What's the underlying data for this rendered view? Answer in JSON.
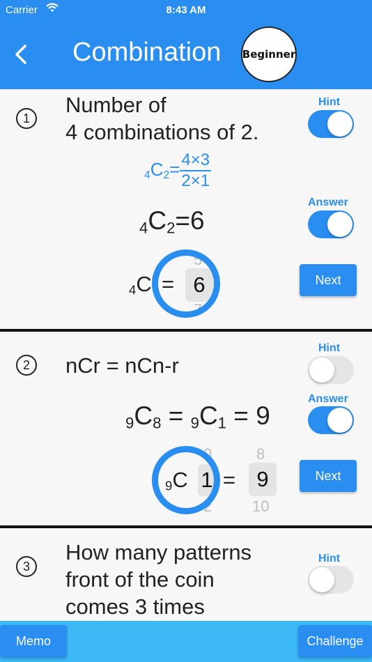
{
  "status": {
    "carrier": "Carrier",
    "time": "8:43 AM"
  },
  "header": {
    "title": "Combination",
    "badge": "Beginner"
  },
  "problems": [
    {
      "number": "1",
      "question": [
        "Number of",
        "4 combinations of 2."
      ],
      "hint_label": "Hint",
      "hint_on": true,
      "hint_formula": {
        "n": "4",
        "c": "C",
        "r": "2",
        "eq": "=",
        "numerator": "4×3",
        "denominator": "2×1"
      },
      "answer_label": "Answer",
      "answer_on": true,
      "answer_formula": {
        "n": "4",
        "c": "C",
        "r": "2",
        "eq": "=",
        "value": "6"
      },
      "input": {
        "n": "4",
        "c": "C",
        "eq": "=",
        "value": "6",
        "ghost_above": "5",
        "ghost_below": "7"
      },
      "next_label": "Next"
    },
    {
      "number": "2",
      "question": [
        "nCr = nCn-r"
      ],
      "hint_label": "Hint",
      "hint_on": false,
      "answer_label": "Answer",
      "answer_on": true,
      "answer_formula": {
        "n1": "9",
        "c1": "C",
        "r1": "8",
        "eq1": " = ",
        "n2": "9",
        "c2": "C",
        "r2": "1",
        "eq2": " = ",
        "value": "9"
      },
      "input": {
        "n": "9",
        "c": "C",
        "picker_value": "1",
        "picker_above": "0",
        "picker_below": "2",
        "eq": "=",
        "value": "9",
        "value_above": "8",
        "value_below": "10"
      },
      "next_label": "Next"
    },
    {
      "number": "3",
      "question": [
        "How many patterns",
        "front of the coin",
        "comes 3 times"
      ],
      "hint_label": "Hint",
      "hint_on": false
    }
  ],
  "bottom": {
    "memo": "Memo",
    "challenge": "Challenge"
  },
  "colors": {
    "primary": "#2a8ef0",
    "bottom_bar": "#3cb8f5"
  }
}
